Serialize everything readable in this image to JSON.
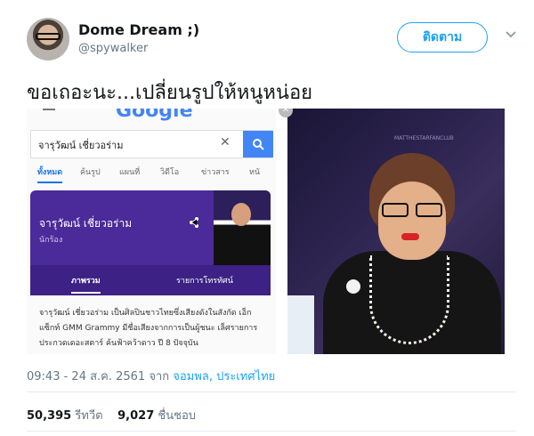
{
  "author": {
    "name": "Dome Dream ;)",
    "handle": "@spywalker",
    "follow_label": "ติดตาม"
  },
  "tweet": {
    "text": "ขอเถอะนะ...เปลี่ยนรูปให้หนูหน่อย"
  },
  "screenshot": {
    "google_logo": "Google",
    "search_query": "จารุวัฒน์ เชี่ยวอร่าม",
    "tabs": [
      "ทั้งหมด",
      "ค้นรูป",
      "แผนที่",
      "วิดีโอ",
      "ข่าวสาร",
      "หนั"
    ],
    "knowledge_name": "จารุวัฒน์ เชี่ยวอร่าม",
    "knowledge_role": "นักร้อง",
    "panel_tabs": [
      "ภาพรวม",
      "รายการโทรทัศน์"
    ],
    "description": "จารุวัฒน์ เชี่ยวอร่าม เป็นศิลปินชาวไทยซึ่งเสียงดังในสังกัด เอ็กแซ็กท์ GMM Grammy มีชื่อเสียงจากการเป็นผู้ชนะ เล็ศรายการประกวดเดอะสตาร์ ค้นฟ้าคว้าดาว ปี 8 ปัจจุบัน"
  },
  "photo": {
    "watermark": "MATTHESTARFANCLUB"
  },
  "meta": {
    "time": "09:43 - 24 ส.ค. 2561",
    "from": "จาก",
    "location": "จอมพล, ประเทศไทย"
  },
  "stats": {
    "retweets_count": "50,395",
    "retweets_label": "รีทวีต",
    "likes_count": "9,027",
    "likes_label": "ชื่นชอบ"
  },
  "colors": {
    "accent": "#1da1f2",
    "panel": "#4b2a99"
  }
}
